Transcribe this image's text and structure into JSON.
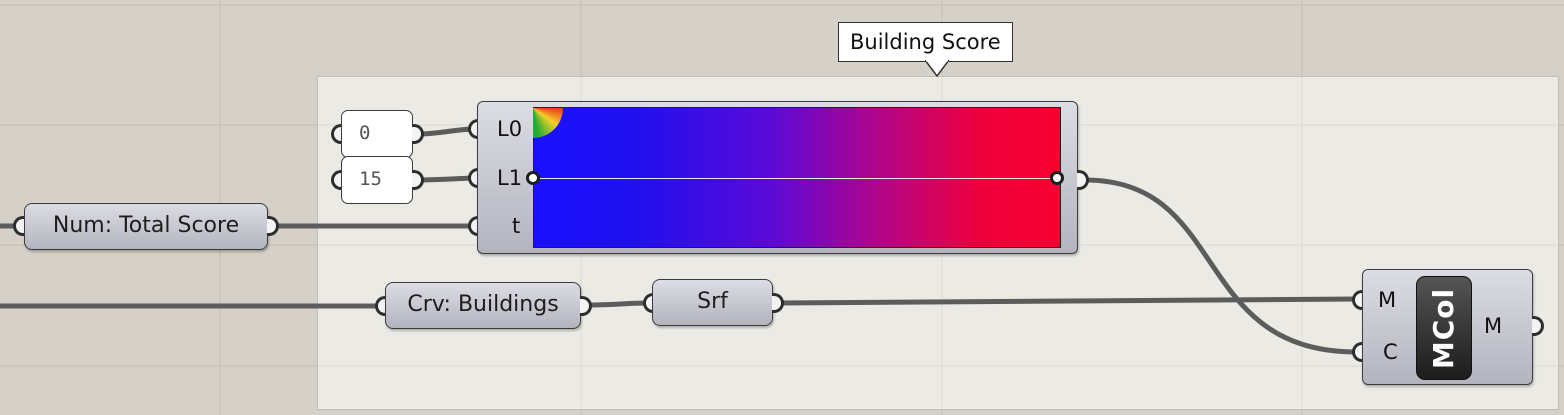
{
  "colors": {
    "canvas": "#d5d1c8",
    "group": "#ebeae5",
    "component": "#c8c8d0",
    "wire": "#5c5c5c",
    "gradient_start": "#1a10ff",
    "gradient_end": "#f80030"
  },
  "tooltip": {
    "text": "Building Score"
  },
  "sliders": [
    {
      "value": "0"
    },
    {
      "value": "15"
    }
  ],
  "params": {
    "total_score": "Num: Total Score",
    "buildings": "Crv: Buildings",
    "surface": "Srf"
  },
  "gradient": {
    "inputs": [
      "L0",
      "L1",
      "t"
    ]
  },
  "mcol": {
    "name": "MCol",
    "inputs": [
      "M",
      "C"
    ],
    "output": "M"
  },
  "icons": [
    "gradient-corner-icon",
    "input-grip-icon",
    "output-grip-icon"
  ]
}
